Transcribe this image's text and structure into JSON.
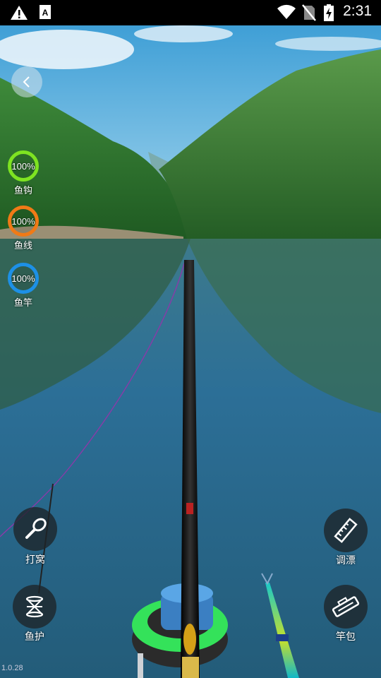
{
  "status_bar": {
    "time": "2:31",
    "icons": [
      "warning-icon",
      "notification-a-icon",
      "wifi-icon",
      "no-sim-icon",
      "battery-charging-icon"
    ]
  },
  "gauges": [
    {
      "name": "hook",
      "label": "鱼钩",
      "value": "100%",
      "level": 1.0,
      "color": "#7ee321"
    },
    {
      "name": "line",
      "label": "鱼线",
      "value": "100%",
      "level": 1.0,
      "color": "#f07a16"
    },
    {
      "name": "rod",
      "label": "鱼竿",
      "value": "100%",
      "level": 1.0,
      "color": "#1d90e6"
    }
  ],
  "actions": {
    "bait": "打窝",
    "float": "调漂",
    "fish_net": "鱼护",
    "rod_bag": "竿包"
  },
  "version": "1.0.28",
  "colors": {
    "sky": "#5fb0dc",
    "water": "#2a6f94",
    "rod": "#151515"
  }
}
